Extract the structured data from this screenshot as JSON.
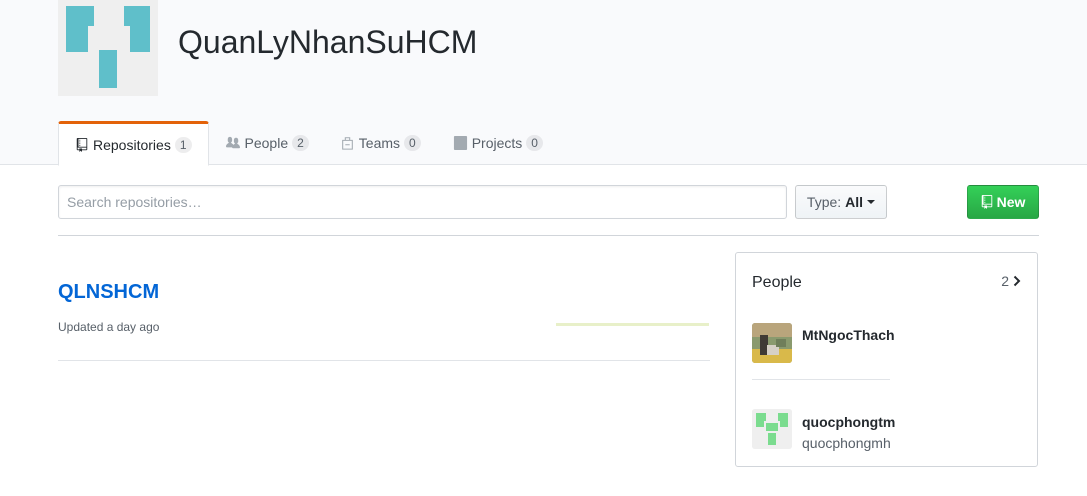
{
  "org": {
    "name": "QuanLyNhanSuHCM",
    "avatar_color": "#5fbfca"
  },
  "tabs": [
    {
      "label": "Repositories",
      "count": "1",
      "icon": "repo-icon",
      "active": true
    },
    {
      "label": "People",
      "count": "2",
      "icon": "people-icon",
      "active": false
    },
    {
      "label": "Teams",
      "count": "0",
      "icon": "teams-icon",
      "active": false
    },
    {
      "label": "Projects",
      "count": "0",
      "icon": "project-icon",
      "active": false
    }
  ],
  "toolbar": {
    "search_placeholder": "Search repositories…",
    "type_label": "Type:",
    "type_value": "All",
    "new_label": "New",
    "new_color": "#28a745"
  },
  "repos": [
    {
      "name": "QLNSHCM",
      "updated": "Updated a day ago"
    }
  ],
  "people_box": {
    "title": "People",
    "count": "2",
    "members": [
      {
        "login": "MtNgocThach",
        "name": ""
      },
      {
        "login": "quocphongtm",
        "name": "quocphongmh"
      }
    ]
  },
  "colors": {
    "accent_tab": "#e36209",
    "link": "#0366d6"
  }
}
